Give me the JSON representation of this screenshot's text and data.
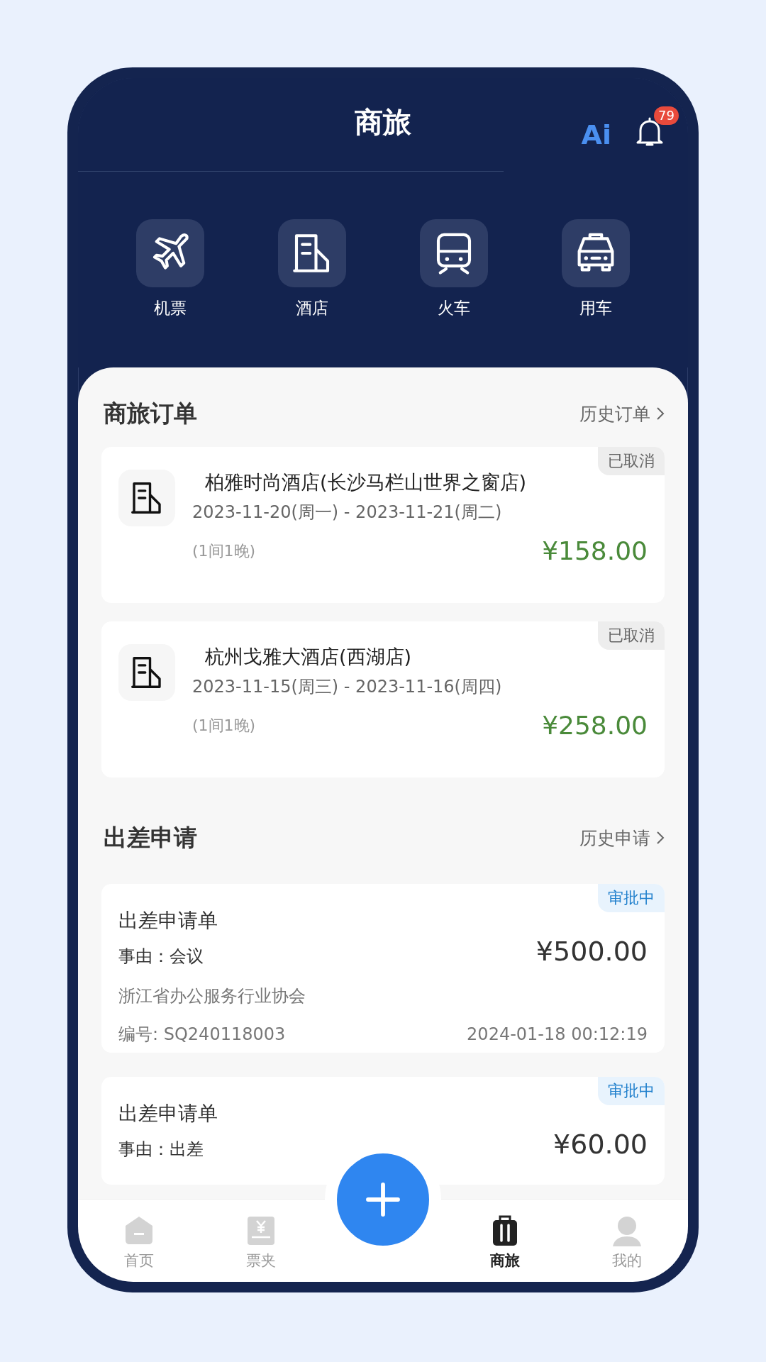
{
  "header": {
    "title": "商旅",
    "ai_label": "Ai",
    "notification_count": "79"
  },
  "services": [
    {
      "label": "机票",
      "kind": "plane"
    },
    {
      "label": "酒店",
      "kind": "hotel"
    },
    {
      "label": "火车",
      "kind": "train"
    },
    {
      "label": "用车",
      "kind": "car"
    }
  ],
  "orders_section": {
    "title": "商旅订单",
    "link": "历史订单"
  },
  "orders": [
    {
      "name": "柏雅时尚酒店(长沙马栏山世界之窗店)",
      "dates": "2023-11-20(周一) - 2023-11-21(周二)",
      "rooms": "(1间1晚)",
      "price": "¥158.00",
      "status": "已取消"
    },
    {
      "name": "杭州戈雅大酒店(西湖店)",
      "dates": "2023-11-15(周三) - 2023-11-16(周四)",
      "rooms": "(1间1晚)",
      "price": "¥258.00",
      "status": "已取消"
    }
  ],
  "applications_section": {
    "title": "出差申请",
    "link": "历史申请"
  },
  "applications": [
    {
      "title": "出差申请单",
      "reason": "事由：会议",
      "price": "¥500.00",
      "organization": "浙江省办公服务行业协会",
      "number": "编号: SQ240118003",
      "time": "2024-01-18 00:12:19",
      "status": "审批中"
    },
    {
      "title": "出差申请单",
      "reason": "事由：出差",
      "price": "¥60.00",
      "status": "审批中"
    }
  ],
  "tab_bar": {
    "items": [
      {
        "label": "首页",
        "kind": "home",
        "selected": false
      },
      {
        "label": "票夹",
        "kind": "ticket",
        "selected": false
      },
      {
        "label": "商旅",
        "kind": "suitcase",
        "selected": true
      },
      {
        "label": "我的",
        "kind": "person",
        "selected": false
      }
    ]
  }
}
